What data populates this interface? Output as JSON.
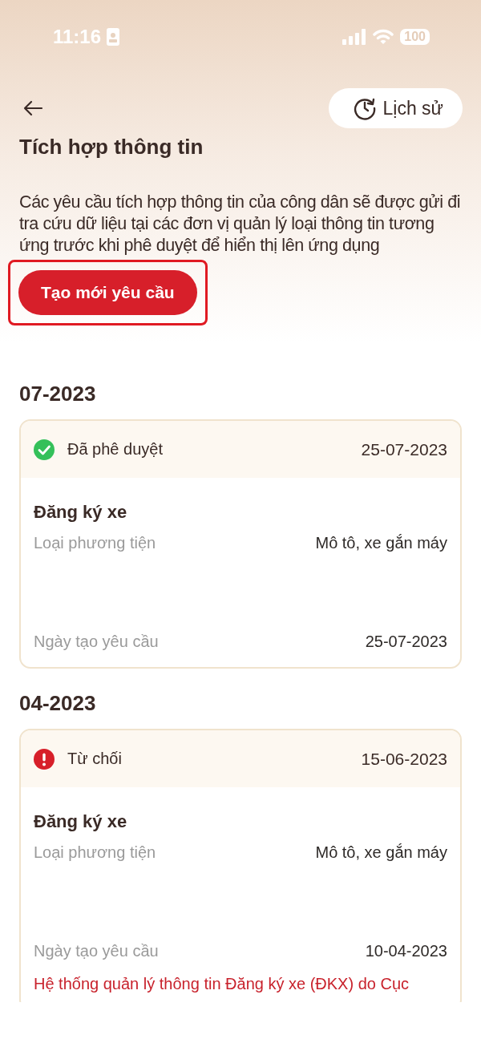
{
  "status_bar": {
    "time": "11:16",
    "battery": "100"
  },
  "header": {
    "history_button": "Lịch sử",
    "title": "Tích hợp thông tin",
    "description": "Các yêu cầu tích hợp thông tin của công dân sẽ được gửi đi tra cứu dữ liệu tại các đơn vị quản lý loại thông tin tương ứng trước khi phê duyệt để hiển thị lên ứng dụng"
  },
  "create_button": {
    "label": "Tạo mới yêu cầu",
    "highlighted": true
  },
  "groups": [
    {
      "month": "07-2023",
      "requests": [
        {
          "kind": "approved",
          "status_label": "Đã phê duyệt",
          "status_date": "25-07-2023",
          "title": "Đăng ký xe",
          "fields": [
            {
              "label": "Loại phương tiện",
              "value": "Mô tô, xe gắn máy"
            },
            {
              "label": "Ngày tạo yêu cầu",
              "value": "25-07-2023"
            }
          ]
        }
      ]
    },
    {
      "month": "04-2023",
      "requests": [
        {
          "kind": "rejected",
          "status_label": "Từ chối",
          "status_date": "15-06-2023",
          "title": "Đăng ký xe",
          "fields": [
            {
              "label": "Loại phương tiện",
              "value": "Mô tô, xe gắn máy"
            },
            {
              "label": "Ngày tạo yêu cầu",
              "value": "10-04-2023"
            }
          ],
          "note": "Hệ thống quản lý thông tin Đăng ký xe (ĐKX) do Cục"
        }
      ]
    }
  ]
}
